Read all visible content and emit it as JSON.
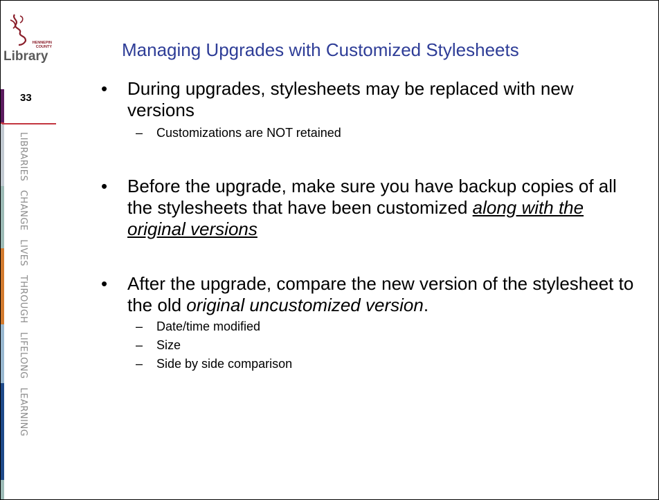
{
  "logo": {
    "wordmark": "Library",
    "county_line1": "HENNEPIN",
    "county_line2": "COUNTY",
    "icon": "hennepin-library-logo"
  },
  "sidebar": {
    "slide_number": "33",
    "tagline": "LIBRARIES CHANGE LIVES THROUGH LIFELONG LEARNING",
    "colors": [
      "#5b1b5e",
      "#c2343f",
      "#9cbbb6",
      "#c9a24a",
      "#d37b2f",
      "#98b8d0",
      "#1f4a8a",
      "#7faa4a"
    ]
  },
  "slide": {
    "title": "Managing Upgrades with Customized Stylesheets",
    "bullet1": {
      "text": "During upgrades, stylesheets may be replaced with new versions",
      "subs": [
        "Customizations are NOT retained"
      ]
    },
    "bullet2": {
      "text_prefix": "Before the upgrade, make sure you have backup copies of all the stylesheets that have been customized ",
      "text_emphasis": "along with the original versions"
    },
    "bullet3": {
      "text_prefix": "After the upgrade, compare the new version of the stylesheet to the old ",
      "text_emphasis": "original uncustomized version",
      "text_suffix": ".",
      "subs": [
        "Date/time modified",
        "Size",
        "Side by side comparison"
      ]
    },
    "bullet_glyph": "•",
    "dash_glyph": "–"
  }
}
